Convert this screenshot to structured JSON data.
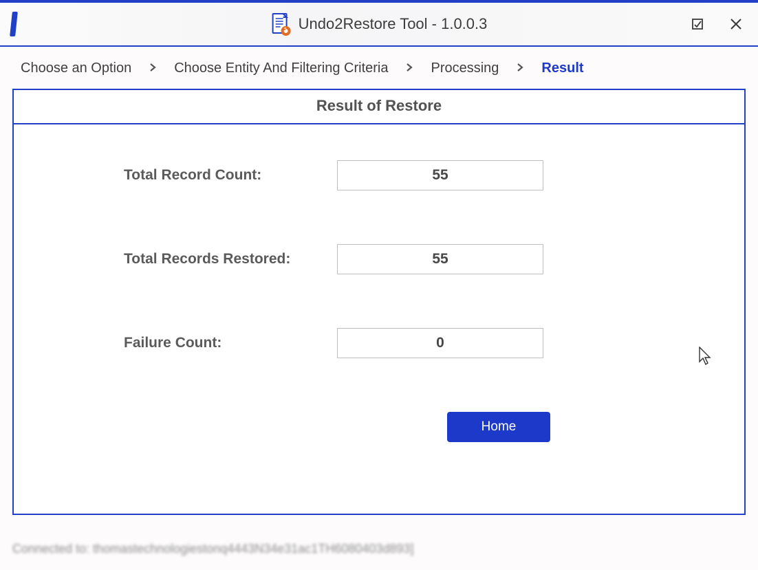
{
  "app": {
    "title": "Undo2Restore Tool - 1.0.0.3"
  },
  "breadcrumb": {
    "step1": "Choose an Option",
    "step2": "Choose Entity And Filtering Criteria",
    "step3": "Processing",
    "step4": "Result"
  },
  "panel": {
    "header": "Result of Restore",
    "rows": {
      "total_count_label": "Total Record Count:",
      "total_count_value": "55",
      "restored_label": "Total Records Restored:",
      "restored_value": "55",
      "failure_label": "Failure Count:",
      "failure_value": "0"
    },
    "home_button": "Home"
  },
  "status": {
    "text": "Connected to: thomastechnologiestonq4443N34e31ac1TH6080403d893]"
  },
  "colors": {
    "accent": "#2140c7"
  }
}
